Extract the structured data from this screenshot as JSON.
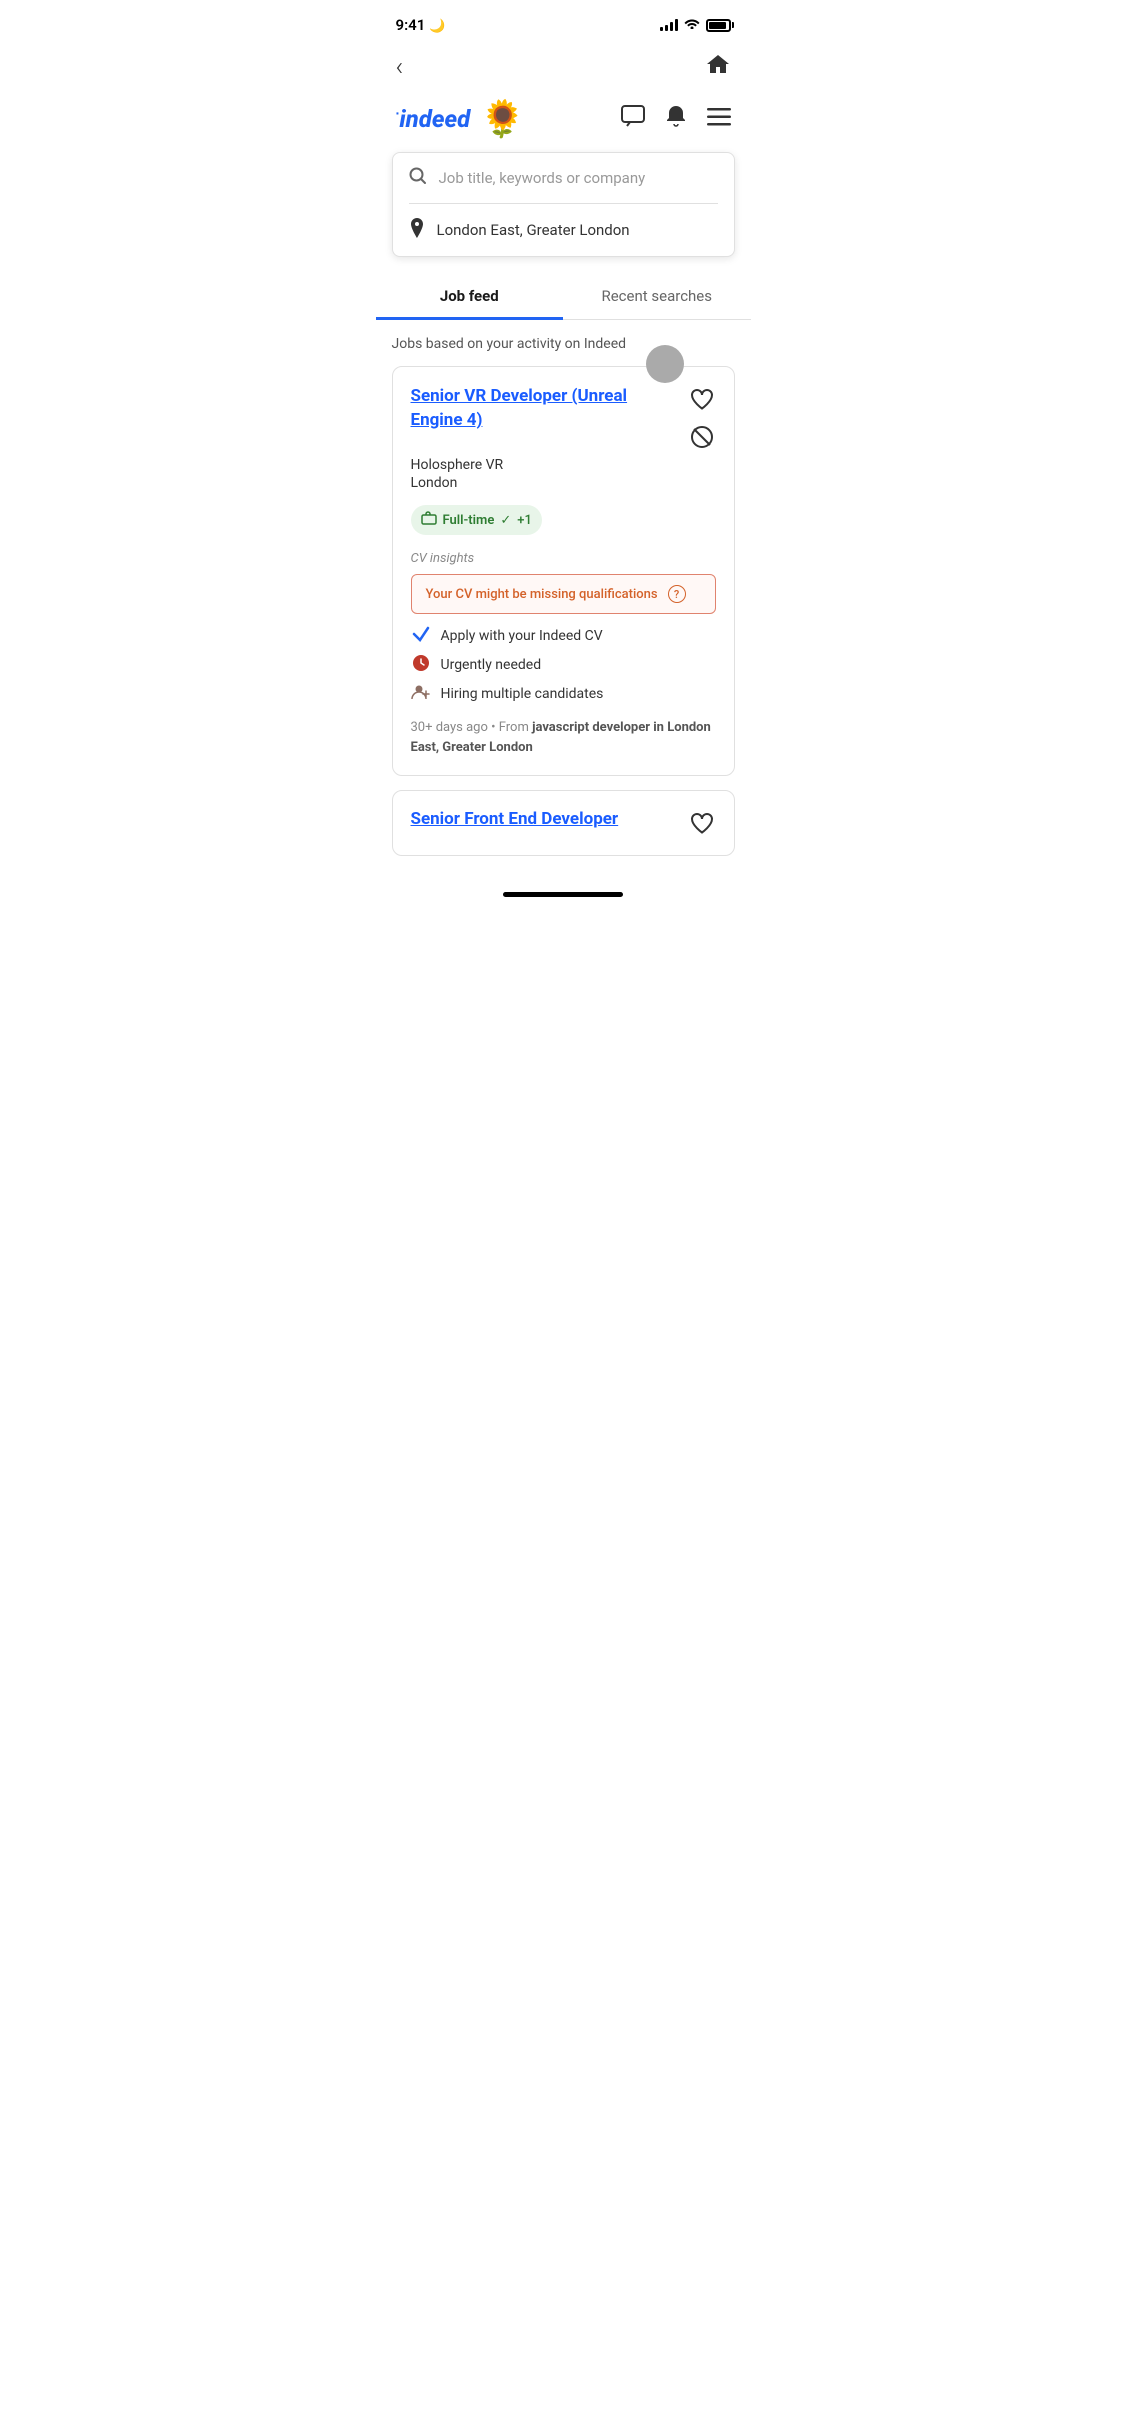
{
  "statusBar": {
    "time": "9:41",
    "moonIcon": "🌙"
  },
  "navBar": {
    "backLabel": "‹",
    "homeLabel": "⌂"
  },
  "header": {
    "logoText": "indeed",
    "sunflower": "🌻",
    "messageIcon": "💬",
    "bellIcon": "🔔",
    "menuIcon": "☰"
  },
  "search": {
    "jobPlaceholder": "Job title, keywords or company",
    "locationText": "London East, Greater London"
  },
  "tabs": [
    {
      "label": "Job feed",
      "active": true
    },
    {
      "label": "Recent searches",
      "active": false
    }
  ],
  "sectionTitle": "Jobs based on your activity on Indeed",
  "jobCard": {
    "title": "Senior VR Developer (Unreal Engine 4)",
    "company": "Holosphere VR",
    "location": "London",
    "tag": "Full-time",
    "tagExtra": "+1",
    "cvInsightsLabel": "CV insights",
    "cvWarning": "Your CV might be missing qualifications",
    "cvWarningIcon": "?",
    "features": [
      {
        "icon": "apply",
        "text": "Apply with your Indeed CV"
      },
      {
        "icon": "clock",
        "text": "Urgently needed"
      },
      {
        "icon": "people",
        "text": "Hiring multiple candidates"
      }
    ],
    "metaAge": "30+ days ago",
    "metaSource": "From ",
    "metaSourceBold": "javascript developer in London East, Greater London"
  },
  "previewCard": {
    "title": "Senior Front End Developer"
  }
}
